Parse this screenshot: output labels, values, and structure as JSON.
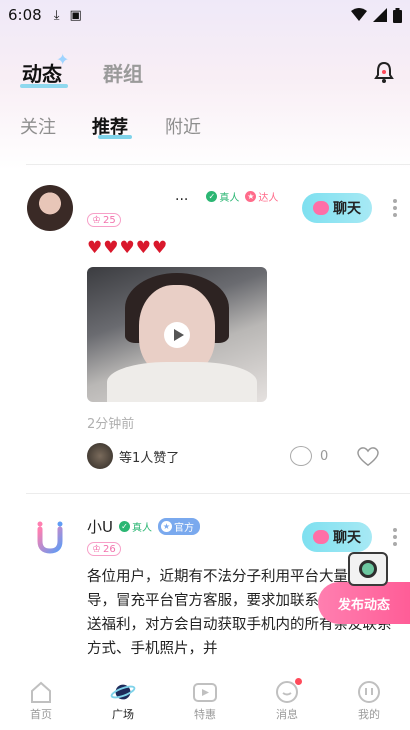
{
  "status_bar": {
    "time": "6:08",
    "icons": [
      "download-icon",
      "app-icon",
      "wifi-icon",
      "signal-icon",
      "battery-icon"
    ]
  },
  "header": {
    "tab_moments": "动态",
    "tab_groups": "群组",
    "bell_icon": "bell-icon"
  },
  "sub_tabs": {
    "follow": "关注",
    "recommend": "推荐",
    "nearby": "附近"
  },
  "posts": [
    {
      "name": "...",
      "badge_real": "真人",
      "badge_talent": "达人",
      "level": "25",
      "chat_label": "聊天",
      "content": "♥♥♥♥♥",
      "time_ago": "2分钟前",
      "likers_text": "等1人赞了",
      "comment_count": "0"
    },
    {
      "name": "小U",
      "badge_real": "真人",
      "badge_official": "官方",
      "level": "26",
      "chat_label": "聊天",
      "content": "各位用户，近期有不法分子利用平台大量告诱导，冒充平台官方客服，要求加联系方式返现、送福利，对方会自动获取手机内的所有亲友联系方式、手机照片，并"
    }
  ],
  "fab": {
    "label": "发布动态"
  },
  "tab_bar": {
    "items": [
      {
        "label": "首页",
        "icon": "home-icon"
      },
      {
        "label": "广场",
        "icon": "planet-icon"
      },
      {
        "label": "特惠",
        "icon": "video-icon"
      },
      {
        "label": "消息",
        "icon": "message-icon"
      },
      {
        "label": "我的",
        "icon": "profile-icon"
      }
    ]
  },
  "colors": {
    "accent": "#8fd8ee",
    "pink": "#ff6fa7",
    "heart": "#d9182c"
  }
}
